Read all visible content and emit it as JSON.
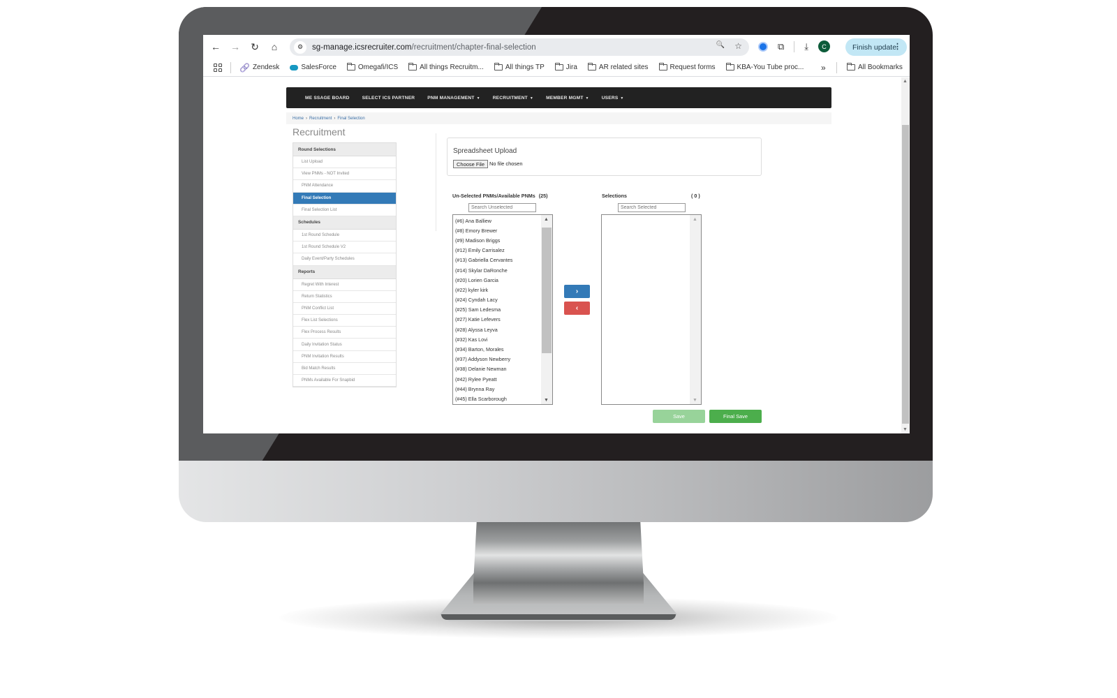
{
  "browser": {
    "url_host": "sg-manage.icsrecruiter.com",
    "url_path": "/recruitment/chapter-final-selection",
    "finish_update_label": "Finish update",
    "avatar_initial": "C",
    "icons": {
      "back": "←",
      "forward": "→",
      "reload": "↻",
      "home": "⌂",
      "site_info": "⚙",
      "zoom": "🔍",
      "star": "☆",
      "puzzle": "⧉",
      "download": "⤓",
      "kebab": "⋮",
      "more_bookmarks": "»"
    },
    "bookmarks": [
      {
        "label": "Zendesk",
        "icon": "zendesk"
      },
      {
        "label": "SalesForce",
        "icon": "salesforce"
      },
      {
        "label": "Omegafi/ICS",
        "icon": "folder"
      },
      {
        "label": "All things Recruitm...",
        "icon": "folder"
      },
      {
        "label": "All things TP",
        "icon": "folder"
      },
      {
        "label": "Jira",
        "icon": "folder"
      },
      {
        "label": "AR related sites",
        "icon": "folder"
      },
      {
        "label": "Request forms",
        "icon": "folder"
      },
      {
        "label": "KBA-You Tube proc...",
        "icon": "folder"
      }
    ],
    "all_bookmarks_label": "All Bookmarks"
  },
  "nav": {
    "items": [
      {
        "label": "ME SSAGE BOARD",
        "dropdown": false
      },
      {
        "label": "SELECT ICS PARTNER",
        "dropdown": false
      },
      {
        "label": "PNM MANAGEMENT",
        "dropdown": true
      },
      {
        "label": "RECRUITMENT",
        "dropdown": true
      },
      {
        "label": "MEMBER MGMT",
        "dropdown": true
      },
      {
        "label": "USERS",
        "dropdown": true
      }
    ],
    "caret": "▼"
  },
  "breadcrumb": [
    "Home",
    "Recruitment",
    "Final Selection"
  ],
  "breadcrumb_sep": "›",
  "page_title": "Recruitment",
  "sidebar": {
    "sections": [
      {
        "title": "Round Selections",
        "items": [
          "List Upload",
          "View PNMs - NOT Invited",
          "PNM Attendance",
          "Final Selection",
          "Final Selection List"
        ]
      },
      {
        "title": "Schedules",
        "items": [
          "1st Round Schedule",
          "1st Round Schedule V2",
          "Daily Event/Party Schedules"
        ]
      },
      {
        "title": "Reports",
        "items": [
          "Regret With Interest",
          "Return Statistics",
          "PNM Conflict List",
          "Flex List Selections",
          "Flex Process Results",
          "Daily Invitation Status",
          "PNM Invitation Results",
          "Bid Match Results",
          "PNMs Available For Snapbid"
        ]
      }
    ],
    "active_item": "Final Selection"
  },
  "upload": {
    "title": "Spreadsheet Upload",
    "choose_file_label": "Choose File",
    "no_file_label": "No file chosen"
  },
  "unselected": {
    "label": "Un-Selected PNMs/Available PNMs",
    "count": "(25)",
    "search_placeholder": "Search Unselected",
    "options": [
      "(#6) Ana Balliew",
      "(#8) Emory Brewer",
      "(#9) Madison Briggs",
      "(#12) Emily Carrisalez",
      "(#13) Gabriella Cervantes",
      "(#14) Skylar DaRonche",
      "(#20) Lorien Garcia",
      "(#22) kyler kirk",
      "(#24) Cyndah Lacy",
      "(#25) Sam Ledesma",
      "(#27) Katie Lefevers",
      "(#28) Alyssa Leyva",
      "(#32) Kas Lovi",
      "(#34) Barton, Morales",
      "(#37) Addyson Newberry",
      "(#38) Delanie Newman",
      "(#42) Rylee Pyeatt",
      "(#44) Brynna Ray",
      "(#45) Ella Scarborough"
    ]
  },
  "selected": {
    "label": "Selections",
    "count": "( 0 )",
    "search_placeholder": "Search Selected",
    "options": []
  },
  "move": {
    "right_glyph": "›",
    "left_glyph": "‹"
  },
  "actions": {
    "save_label": "Save",
    "final_save_label": "Final Save"
  },
  "colors": {
    "primary": "#337ab7",
    "danger": "#d9534f",
    "success": "#4cae4c",
    "success_disabled": "#98d39a",
    "nav_bg": "#222222"
  }
}
